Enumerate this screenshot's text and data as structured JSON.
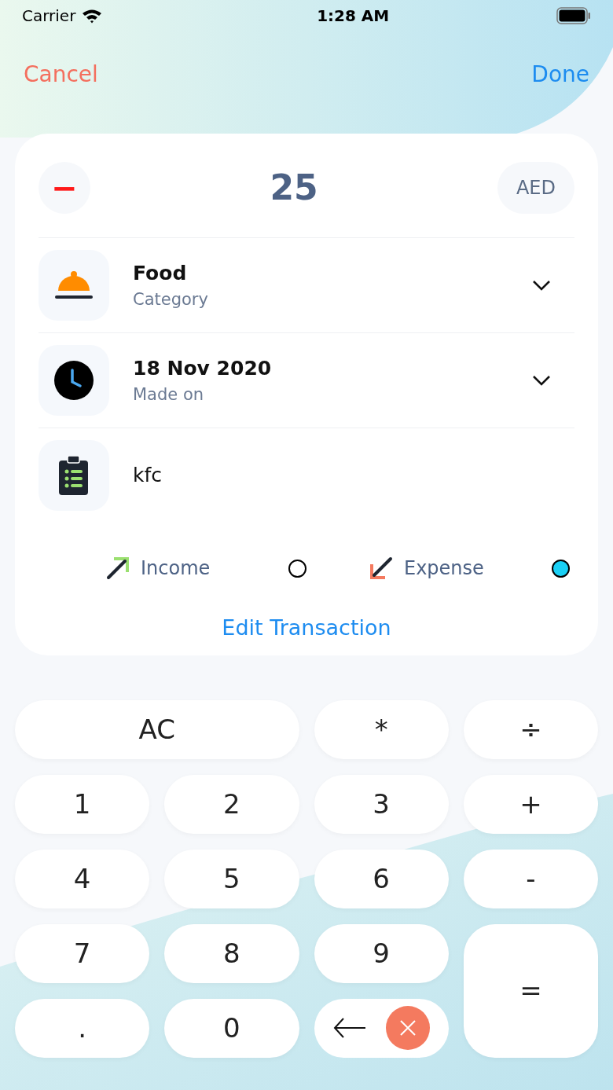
{
  "status_bar": {
    "carrier": "Carrier",
    "time": "1:28 AM"
  },
  "nav": {
    "cancel": "Cancel",
    "done": "Done"
  },
  "amount": {
    "sign": "−",
    "value": "25",
    "currency": "AED"
  },
  "fields": [
    {
      "kind": "category",
      "title": "Food",
      "subtitle": "Category",
      "expandable": true
    },
    {
      "kind": "date",
      "title": "18 Nov 2020",
      "subtitle": "Made on",
      "expandable": true
    },
    {
      "kind": "note",
      "title": "kfc",
      "expandable": false
    }
  ],
  "types": [
    {
      "kind": "income",
      "label": "Income",
      "selected": false
    },
    {
      "kind": "expense",
      "label": "Expense",
      "selected": true
    }
  ],
  "action": "Edit Transaction",
  "keys": [
    {
      "label": "AC",
      "kind": "wide"
    },
    {
      "label": "*",
      "kind": "key"
    },
    {
      "label": "÷",
      "kind": "key"
    },
    {
      "label": "1",
      "kind": "key"
    },
    {
      "label": "2",
      "kind": "key"
    },
    {
      "label": "3",
      "kind": "key"
    },
    {
      "label": "+",
      "kind": "key"
    },
    {
      "label": "4",
      "kind": "key"
    },
    {
      "label": "5",
      "kind": "key"
    },
    {
      "label": "6",
      "kind": "key"
    },
    {
      "label": "-",
      "kind": "key"
    },
    {
      "label": "7",
      "kind": "key"
    },
    {
      "label": "8",
      "kind": "key"
    },
    {
      "label": "9",
      "kind": "key"
    },
    {
      "label": "=",
      "kind": "tall"
    },
    {
      "label": ".",
      "kind": "key"
    },
    {
      "label": "0",
      "kind": "key"
    },
    {
      "kind": "backspace"
    }
  ]
}
